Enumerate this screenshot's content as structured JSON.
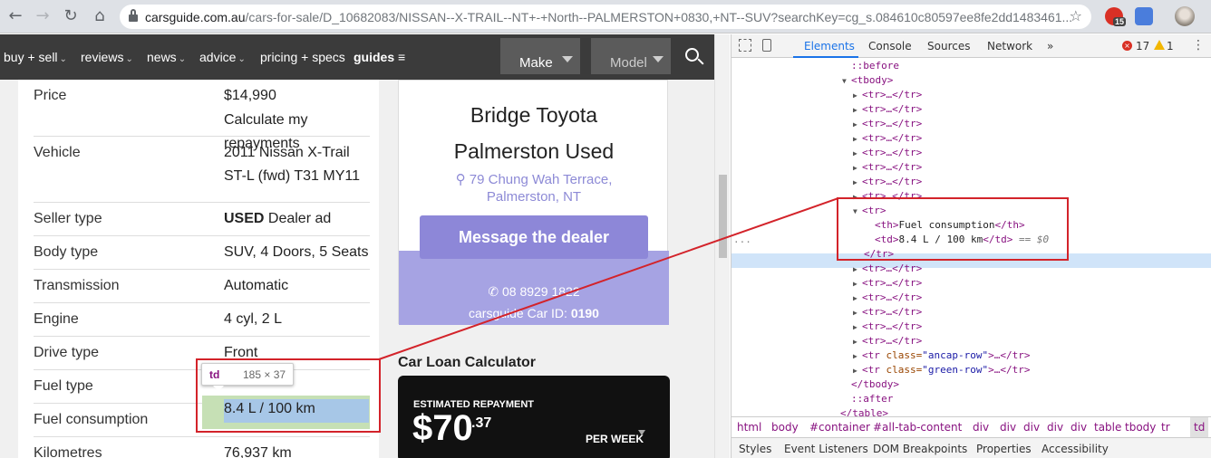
{
  "browser": {
    "url_domain": "carsguide.com.au",
    "url_path": "/cars-for-sale/D_10682083/NISSAN--X-TRAIL--NT+-+North--PALMERSTON+0830,+NT--SUV?searchKey=cg_s.084610c80597ee8fe2dd1483461...",
    "extension_badge": "15",
    "back_icon": "←",
    "forward_icon": "→",
    "reload_icon": "↻",
    "home_icon": "⌂",
    "star_icon": "☆"
  },
  "site_nav": {
    "items": [
      {
        "label": "buy + sell",
        "chevron": "⌄"
      },
      {
        "label": "reviews",
        "chevron": "⌄"
      },
      {
        "label": "news",
        "chevron": "⌄"
      },
      {
        "label": "advice",
        "chevron": "⌄"
      },
      {
        "label": "pricing + specs",
        "chevron": ""
      },
      {
        "label": "guides",
        "chevron": "≡"
      }
    ],
    "make_label": "Make",
    "model_label": "Model"
  },
  "specs": {
    "rows": [
      {
        "label": "Price",
        "value": "$14,990",
        "link": "Calculate my repayments"
      },
      {
        "label": "Vehicle",
        "value_line1": "2011 Nissan X-Trail",
        "value_line2": "ST-L (fwd) T31 MY11"
      },
      {
        "label": "Seller type",
        "value_bold": "USED",
        "value": " Dealer ad"
      },
      {
        "label": "Body type",
        "value": "SUV, 4 Doors, 5 Seats"
      },
      {
        "label": "Transmission",
        "value": "Automatic"
      },
      {
        "label": "Engine",
        "value": "4 cyl, 2 L"
      },
      {
        "label": "Drive type",
        "value": "Front"
      },
      {
        "label": "Fuel type",
        "value": ""
      },
      {
        "label": "Fuel consumption",
        "value": "8.4 L / 100 km"
      },
      {
        "label": "Kilometres",
        "value": "76,937 km"
      }
    ]
  },
  "inspect_tooltip": {
    "tag": "td",
    "dims": "185 × 37"
  },
  "dealer": {
    "name_line1": "Bridge Toyota",
    "name_line2": "Palmerston Used",
    "address_line1": "79 Chung Wah Terrace,",
    "address_line2": "Palmerston, NT",
    "pin_icon": "📍",
    "message_button": "Message the dealer",
    "phone": "08 8929 1822",
    "phone_icon": "✆",
    "car_id_label": "carsguide Car ID: ",
    "car_id": "0190"
  },
  "loan": {
    "title": "Car Loan Calculator",
    "estimated_label": "ESTIMATED REPAYMENT",
    "amount": "$70",
    "cents": ".37",
    "period": "PER WEEK"
  },
  "devtools": {
    "tabs": [
      "Elements",
      "Console",
      "Sources",
      "Network",
      "»"
    ],
    "active_tab": "Elements",
    "errors": "17",
    "warnings": "1",
    "dom": {
      "before": "::before",
      "tbody_open": "<tbody>",
      "collapsed_tr": "<tr>…</tr>",
      "tr_open": "<tr>",
      "th_open": "<th>",
      "th_text": "Fuel consumption",
      "th_close": "</th>",
      "td_open": "<td>",
      "td_text": "8.4 L / 100 km",
      "td_close": "</td>",
      "selected_marker": "== $0",
      "tr_close": "</tr>",
      "ancap_tag": "<tr",
      "ancap_attr": " class=",
      "ancap_val": "\"ancap-row\"",
      "ancap_end": ">…</tr>",
      "green_val": "\"green-row\"",
      "tbody_close": "</tbody>",
      "after": "::after",
      "table_close": "</table>",
      "dots": "..."
    },
    "breadcrumbs": [
      "html",
      "body",
      "#container",
      "#all-tab-content",
      "div",
      "div",
      "div",
      "div",
      "div",
      "table",
      "tbody",
      "tr",
      "td"
    ],
    "subtabs": [
      "Styles",
      "Event Listeners",
      "DOM Breakpoints",
      "Properties",
      "Accessibility"
    ]
  },
  "colors": {
    "annotation_red": "#d3232a",
    "link_purple": "#7470c8",
    "selected_blue": "#d0e4f9"
  }
}
